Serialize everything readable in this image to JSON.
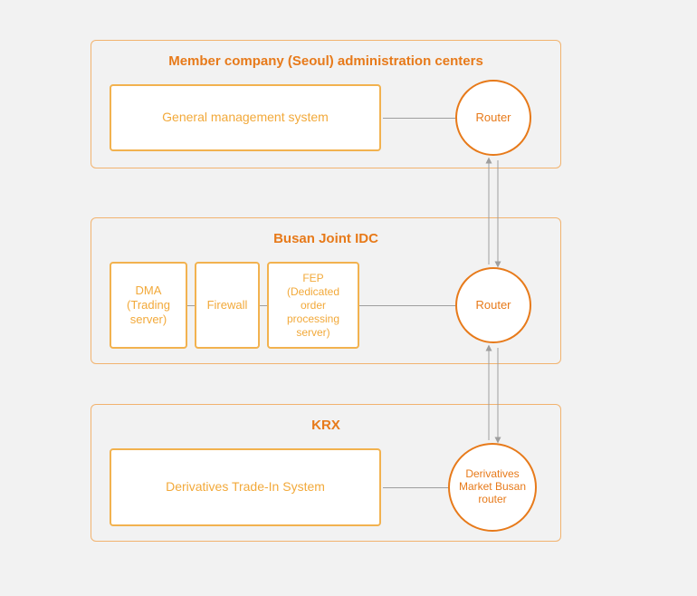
{
  "diagram": {
    "groups": {
      "seoul": {
        "title": "Member company (Seoul) administration centers",
        "gms": "General management system",
        "router": "Router"
      },
      "busan": {
        "title": "Busan Joint IDC",
        "dma": "DMA\n(Trading\nserver)",
        "firewall": "Firewall",
        "fep": "FEP\n(Dedicated\norder\nprocessing\nserver)",
        "router": "Router"
      },
      "krx": {
        "title": "KRX",
        "dti": "Derivatives Trade-In System",
        "router": "Derivatives\nMarket Busan\nrouter"
      }
    },
    "colors": {
      "group_border": "#f2b36f",
      "box_border": "#f2b24f",
      "circle_border": "#e77a1a",
      "text_orange": "#e77a1a",
      "connector": "#9e9e9e"
    }
  }
}
